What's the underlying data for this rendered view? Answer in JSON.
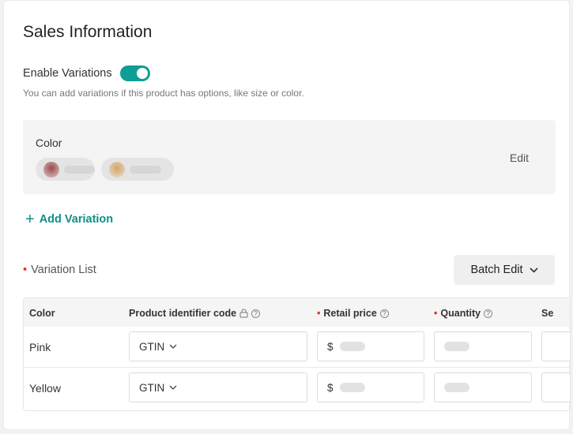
{
  "section": {
    "title": "Sales Information",
    "enable_label": "Enable Variations",
    "enable_on": true,
    "hint": "You can add variations if this product has options, like size or color."
  },
  "variation_group": {
    "label": "Color",
    "edit_label": "Edit"
  },
  "add_variation": {
    "icon": "+",
    "label": "Add Variation"
  },
  "variation_list": {
    "title": "Variation List",
    "required_mark": "•",
    "batch_edit": "Batch Edit",
    "batch_chevron": "⌄"
  },
  "table": {
    "headers": {
      "color": "Color",
      "identifier": "Product identifier code",
      "price": "Retail price",
      "quantity": "Quantity",
      "extra": "Se"
    },
    "rows": [
      {
        "color": "Pink",
        "identifier_type": "GTIN",
        "currency": "$"
      },
      {
        "color": "Yellow",
        "identifier_type": "GTIN",
        "currency": "$"
      }
    ]
  },
  "colors": {
    "accent": "#0f9e96",
    "required": "#e0342f"
  }
}
